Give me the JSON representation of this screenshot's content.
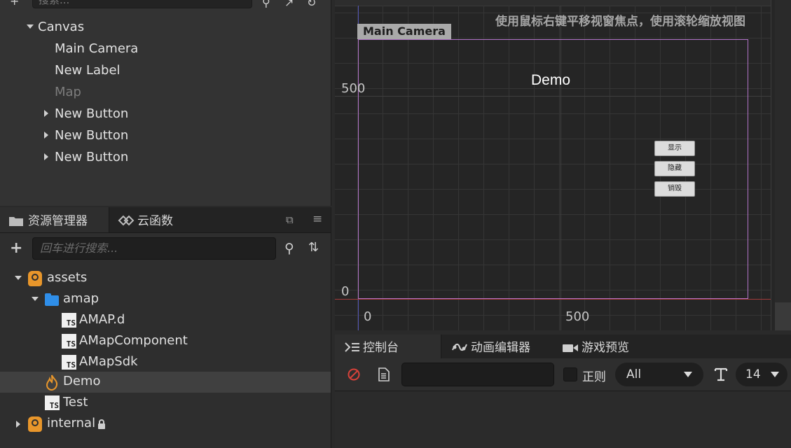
{
  "hierarchy": {
    "search_placeholder": "搜索...",
    "nodes": [
      {
        "label": "Canvas",
        "state": "expanded"
      },
      {
        "label": "Main Camera"
      },
      {
        "label": "New Label"
      },
      {
        "label": "Map",
        "dim": true
      },
      {
        "label": "New Button",
        "state": "collapsed"
      },
      {
        "label": "New Button",
        "state": "collapsed"
      },
      {
        "label": "New Button",
        "state": "collapsed"
      }
    ]
  },
  "assets": {
    "tabs": [
      {
        "label": "资源管理器",
        "icon": "folder-icon"
      },
      {
        "label": "云函数",
        "icon": "cloud-function-icon"
      }
    ],
    "search_placeholder": "回车进行搜索...",
    "items": [
      {
        "label": "assets",
        "icon": "package-icon",
        "state": "expanded"
      },
      {
        "label": "amap",
        "icon": "folder-icon",
        "state": "expanded"
      },
      {
        "label": "AMAP.d",
        "icon": "ts-file-icon"
      },
      {
        "label": "AMapComponent",
        "icon": "ts-file-icon"
      },
      {
        "label": "AMapSdk",
        "icon": "ts-file-icon"
      },
      {
        "label": "Demo",
        "icon": "scene-fire-icon",
        "selected": true
      },
      {
        "label": "Test",
        "icon": "ts-file-icon"
      },
      {
        "label": "internal",
        "icon": "package-icon",
        "state": "collapsed",
        "locked": true
      }
    ],
    "ts_badge": "TS"
  },
  "scene": {
    "hint": "使用鼠标右键平移视窗焦点，使用滚轮缩放视图",
    "camera_label": "Main Camera",
    "y_ticks": [
      "500",
      "0"
    ],
    "x_ticks": [
      "0",
      "500"
    ],
    "demo_title": "Demo",
    "game_buttons": [
      "显示",
      "隐藏",
      "销毁"
    ]
  },
  "console": {
    "tabs": [
      {
        "label": "控制台",
        "icon": "console-icon"
      },
      {
        "label": "动画编辑器",
        "icon": "animation-icon"
      },
      {
        "label": "游戏预览",
        "icon": "video-icon"
      }
    ],
    "regex_label": "正则",
    "level_select": "All",
    "font_size": "14"
  },
  "colors": {
    "accent_orange": "#e8962b",
    "folder_blue": "#2f8ee8",
    "canvas_border": "#b273c8",
    "x_axis": "#a33b3b",
    "y_axis": "#5354b3"
  }
}
